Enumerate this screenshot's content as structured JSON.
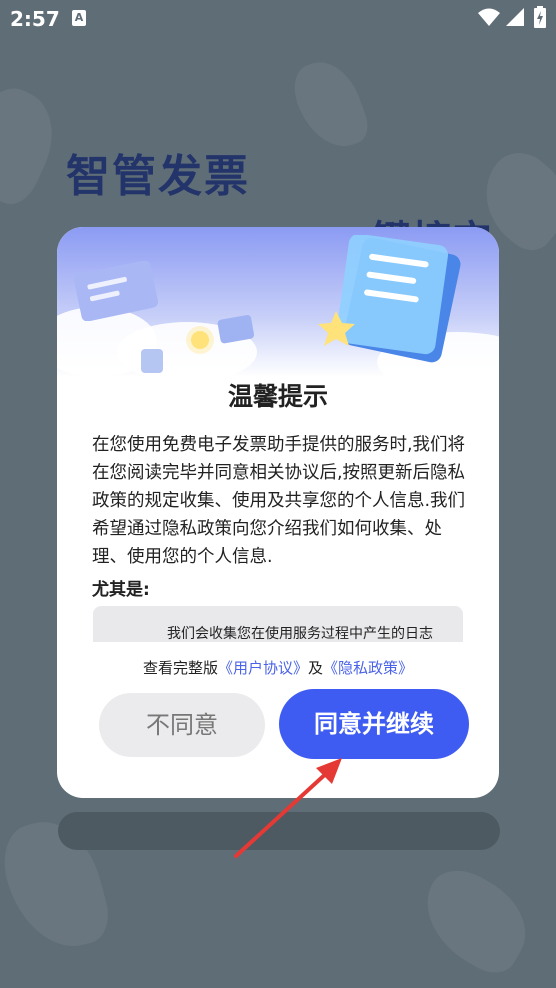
{
  "status_bar": {
    "time": "2:57"
  },
  "background": {
    "title": "智管发票",
    "subtitle": "一键接它"
  },
  "dialog": {
    "title": "温馨提示",
    "body": "在您使用免费电子发票助手提供的服务时,我们将在您阅读完毕并同意相关协议后,按照更新后隐私政策的规定收集、使用及共享您的个人信息.我们希望通过隐私政策向您介绍我们如何收集、处理、使用您的个人信息.",
    "emphasis": "尤其是:",
    "detail": "我们会收集您在使用服务过程中产生的日志",
    "links": {
      "prefix": "查看完整版",
      "user_agreement": "《用户协议》",
      "conjunction": "及",
      "privacy_policy": "《隐私政策》"
    },
    "buttons": {
      "disagree": "不同意",
      "agree": "同意并继续"
    }
  },
  "colors": {
    "accent": "#3f5cf2",
    "link": "#4a63e8",
    "annotation": "#e53935"
  }
}
